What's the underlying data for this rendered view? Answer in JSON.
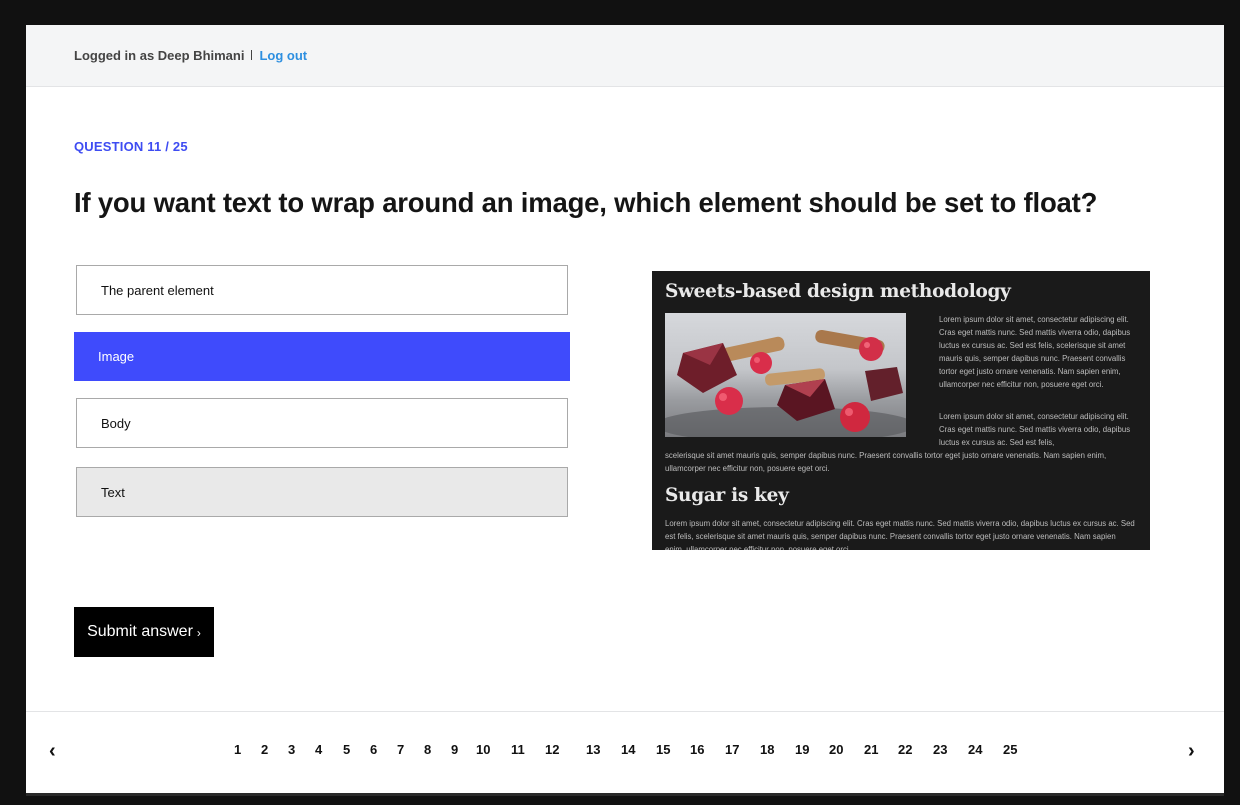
{
  "header": {
    "logged_in_text": "Logged in as Deep Bhimani",
    "logout_label": "Log out"
  },
  "question": {
    "counter": "QUESTION 11 / 25",
    "text": "If you want text to wrap around an image, which element should be set to float?"
  },
  "options": [
    {
      "label": "The parent element",
      "state": "default"
    },
    {
      "label": "Image",
      "state": "selected"
    },
    {
      "label": "Body",
      "state": "default"
    },
    {
      "label": "Text",
      "state": "hover"
    }
  ],
  "preview": {
    "heading1": "Sweets-based design methodology",
    "paragraph1": "Lorem ipsum dolor sit amet, consectetur adipiscing elit. Cras eget mattis nunc. Sed mattis viverra odio, dapibus luctus ex cursus ac. Sed est felis, scelerisque sit amet mauris quis, semper dapibus nunc. Praesent convallis tortor eget justo ornare venenatis. Nam sapien enim, ullamcorper nec efficitur non, posuere eget orci.",
    "paragraph2_wrapped": "Lorem ipsum dolor sit amet, consectetur adipiscing elit. Cras eget mattis nunc. Sed mattis viverra odio, dapibus luctus ex cursus ac. Sed est felis,",
    "paragraph2_full": "scelerisque sit amet mauris quis, semper dapibus nunc. Praesent convallis tortor eget justo ornare venenatis. Nam sapien enim, ullamcorper nec efficitur non, posuere eget orci.",
    "heading2": "Sugar is key",
    "paragraph3": "Lorem ipsum dolor sit amet, consectetur adipiscing elit. Cras eget mattis nunc. Sed mattis viverra odio, dapibus luctus ex cursus ac. Sed est felis, scelerisque sit amet mauris quis, semper dapibus nunc. Praesent convallis tortor eget justo ornare venenatis. Nam sapien enim, ullamcorper nec efficitur non, posuere eget orci."
  },
  "submit": {
    "label": "Submit answer",
    "chevron": "›"
  },
  "pagination": {
    "prev_icon": "‹",
    "next_icon": "›",
    "pages": [
      "1",
      "2",
      "3",
      "4",
      "5",
      "6",
      "7",
      "8",
      "9",
      "10",
      "11",
      "12",
      "13",
      "14",
      "15",
      "16",
      "17",
      "18",
      "19",
      "20",
      "21",
      "22",
      "23",
      "24",
      "25"
    ]
  },
  "colors": {
    "accent": "#3f4bfc",
    "link": "#2d8fe0",
    "counter": "#3e4cf2"
  }
}
